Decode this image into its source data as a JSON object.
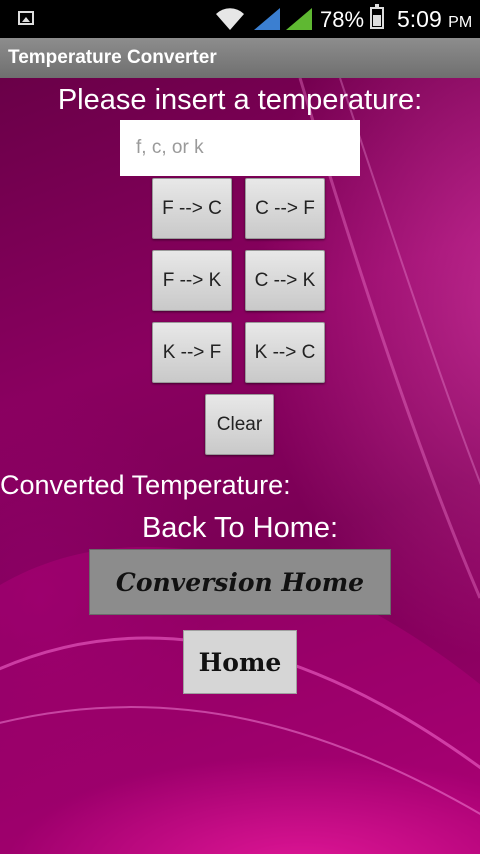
{
  "status_bar": {
    "battery_percent": "78%",
    "time": "5:09",
    "ampm": "PM"
  },
  "app": {
    "title": "Temperature Converter"
  },
  "main": {
    "prompt": "Please insert a temperature:",
    "input_placeholder": "f, c, or k",
    "input_value": "",
    "buttons": {
      "f_to_c": "F --> C",
      "c_to_f": "C --> F",
      "f_to_k": "F --> K",
      "c_to_k": "C --> K",
      "k_to_f": "K --> F",
      "k_to_c": "K --> C",
      "clear": "Clear"
    },
    "converted_label": "Converted Temperature:",
    "back_label": "Back To Home:",
    "conversion_home_button": "Conversion Home",
    "home_button": "Home"
  }
}
